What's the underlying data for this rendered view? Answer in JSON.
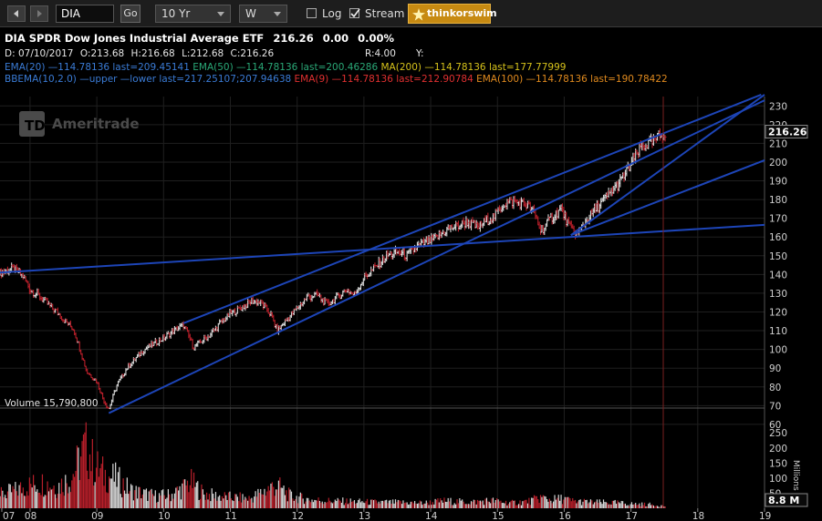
{
  "toolbar": {
    "symbol": "DIA",
    "go_label": "Go",
    "timeframe": "10 Yr",
    "aggregation": "W",
    "log_label": "Log",
    "log_checked": false,
    "stream_label": "Stream",
    "stream_checked": true,
    "brand_label": "thinkorswim"
  },
  "header": {
    "title": "DIA SPDR Dow Jones Industrial Average ETF",
    "last": "216.26",
    "change": "0.00",
    "change_pct": "0.00%",
    "date_label": "D: 07/10/2017",
    "o": "O:213.68",
    "h": "H:216.68",
    "l": "L:212.68",
    "c": "C:216.26",
    "r": "R:4.00",
    "y": "Y:"
  },
  "legend_row1": [
    {
      "text": "EMA(20)",
      "color": "#3a7bd5"
    },
    {
      "text": " —114.78136 last=209.45141 ",
      "color": "#3a7bd5"
    },
    {
      "text": "EMA(50)",
      "color": "#2aa877"
    },
    {
      "text": " —114.78136 last=200.46286 ",
      "color": "#2aa877"
    },
    {
      "text": "MA(200)",
      "color": "#d6c21b"
    },
    {
      "text": " —114.78136 last=177.77999",
      "color": "#d6c21b"
    }
  ],
  "legend_row2": [
    {
      "text": "BBEMA(10,2.0)",
      "color": "#3a7bd5"
    },
    {
      "text": " —upper —lower last=217.25107;207.94638 ",
      "color": "#3a7bd5"
    },
    {
      "text": "EMA(9)",
      "color": "#e03030"
    },
    {
      "text": " —114.78136 last=212.90784 ",
      "color": "#e03030"
    },
    {
      "text": "EMA(100)",
      "color": "#e08a1e"
    },
    {
      "text": " —114.78136 last=190.78422",
      "color": "#e08a1e"
    }
  ],
  "watermark": "Ameritrade",
  "volume": {
    "label": "Volume 15,790,800",
    "axis_title": "Millions",
    "ticks": [
      250,
      200,
      150,
      100,
      50
    ],
    "last_label": "8.8 M"
  },
  "colors": {
    "background": "#000000",
    "grid": "#1f1f1f",
    "up_bar": "#d8d8d8",
    "down_bar": "#b81f2a",
    "trendline": "#1d45b8",
    "cursor_line": "#7a1f1f",
    "axis_text": "#cfcfcf"
  },
  "chart_data": {
    "type": "line",
    "title": "DIA SPDR Dow Jones Industrial Average ETF",
    "aggregation": "weekly",
    "grid": true,
    "price_axis": {
      "ticks": [
        60,
        70,
        80,
        90,
        100,
        110,
        120,
        130,
        140,
        150,
        160,
        170,
        180,
        190,
        200,
        210,
        220,
        230
      ],
      "range": [
        58,
        235
      ]
    },
    "x_tick_labels": [
      "07",
      "08",
      "09",
      "10",
      "11",
      "12",
      "13",
      "14",
      "15",
      "16",
      "17",
      "18",
      "19"
    ],
    "x_range_years": [
      2007.55,
      2019.0
    ],
    "last_price_label": "216.26",
    "price_series": {
      "x": [
        2007.55,
        2007.75,
        2007.9,
        2008.0,
        2008.15,
        2008.3,
        2008.4,
        2008.5,
        2008.65,
        2008.75,
        2008.85,
        2009.0,
        2009.1,
        2009.18,
        2009.3,
        2009.45,
        2009.6,
        2009.75,
        2009.9,
        2010.0,
        2010.15,
        2010.3,
        2010.45,
        2010.55,
        2010.7,
        2010.85,
        2011.0,
        2011.2,
        2011.32,
        2011.45,
        2011.6,
        2011.7,
        2011.85,
        2012.0,
        2012.15,
        2012.3,
        2012.45,
        2012.6,
        2012.75,
        2012.85,
        2013.0,
        2013.2,
        2013.35,
        2013.5,
        2013.65,
        2013.8,
        2014.0,
        2014.1,
        2014.25,
        2014.4,
        2014.55,
        2014.7,
        2014.8,
        2014.95,
        2015.1,
        2015.25,
        2015.45,
        2015.55,
        2015.65,
        2015.8,
        2015.95,
        2016.1,
        2016.2,
        2016.35,
        2016.5,
        2016.65,
        2016.85,
        2017.0,
        2017.15,
        2017.3,
        2017.52
      ],
      "y": [
        141,
        143,
        139,
        132,
        128,
        123,
        120,
        116,
        111,
        100,
        88,
        83,
        73,
        68,
        81,
        90,
        96,
        101,
        104,
        106,
        110,
        113,
        101,
        104,
        108,
        114,
        119,
        123,
        126,
        125,
        119,
        110,
        116,
        122,
        128,
        129,
        124,
        128,
        132,
        129,
        138,
        145,
        150,
        152,
        150,
        155,
        158,
        160,
        164,
        166,
        168,
        165,
        168,
        171,
        178,
        179,
        177,
        173,
        163,
        170,
        175,
        164,
        162,
        170,
        176,
        182,
        190,
        199,
        208,
        210,
        216.26
      ]
    },
    "volume_series_millions": {
      "x": [
        2007.55,
        2007.8,
        2008.0,
        2008.2,
        2008.4,
        2008.6,
        2008.75,
        2008.85,
        2008.95,
        2009.1,
        2009.3,
        2009.5,
        2009.7,
        2009.9,
        2010.1,
        2010.3,
        2010.4,
        2010.6,
        2010.8,
        2011.0,
        2011.3,
        2011.6,
        2011.7,
        2011.9,
        2012.2,
        2012.5,
        2012.8,
        2013.1,
        2013.5,
        2013.9,
        2014.2,
        2014.6,
        2014.9,
        2015.2,
        2015.5,
        2015.65,
        2015.8,
        2016.0,
        2016.1,
        2016.4,
        2016.8,
        2017.0,
        2017.3,
        2017.52
      ],
      "y": [
        55,
        75,
        95,
        105,
        90,
        120,
        200,
        265,
        180,
        140,
        120,
        75,
        60,
        50,
        55,
        85,
        110,
        60,
        50,
        45,
        40,
        85,
        95,
        50,
        35,
        30,
        28,
        25,
        24,
        22,
        30,
        25,
        32,
        22,
        30,
        45,
        35,
        40,
        30,
        25,
        22,
        18,
        15,
        8.8
      ]
    },
    "trendlines": [
      {
        "from": [
          2007.55,
          141
        ],
        "to": [
          2019.0,
          166.5
        ]
      },
      {
        "from": [
          2009.18,
          66
        ],
        "to": [
          2019.0,
          233
        ]
      },
      {
        "from": [
          2010.3,
          114
        ],
        "to": [
          2018.95,
          236
        ]
      },
      {
        "from": [
          2016.1,
          161
        ],
        "to": [
          2019.0,
          201
        ]
      },
      {
        "from": [
          2016.1,
          161
        ],
        "to": [
          2019.0,
          236
        ]
      }
    ]
  }
}
